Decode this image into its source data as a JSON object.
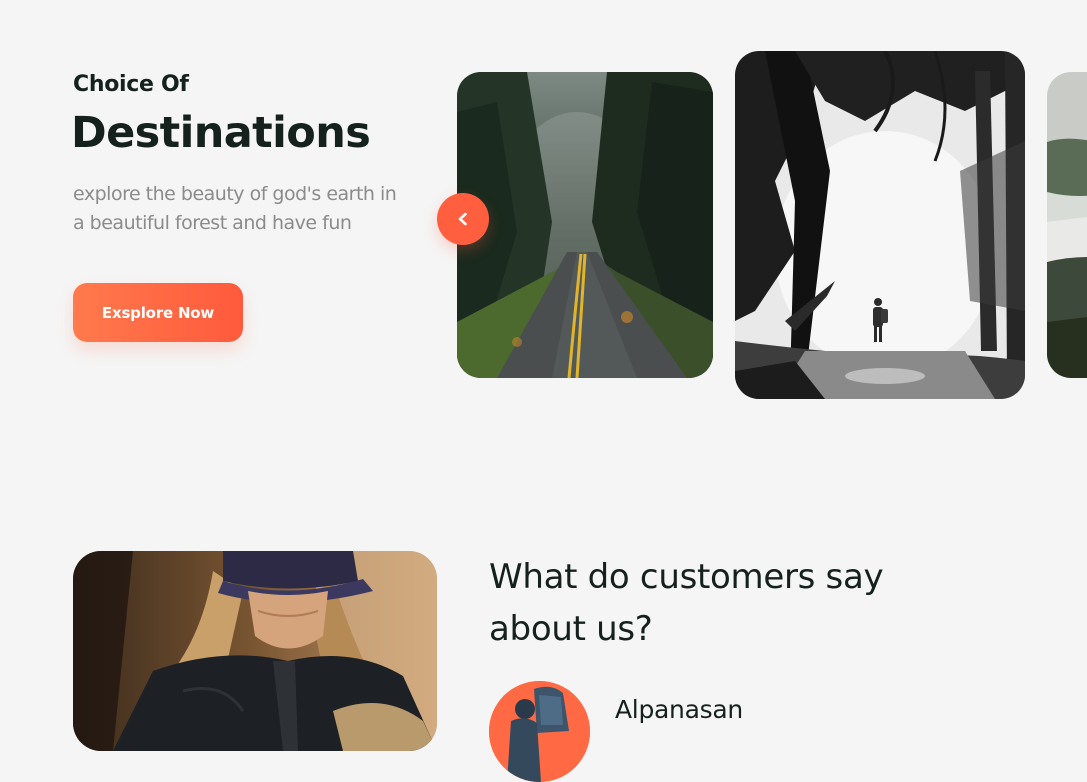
{
  "hero": {
    "eyebrow": "Choice Of",
    "title": "Destinations",
    "description_lines": [
      "explore the beauty of god's earth in",
      "a beautiful forest and have fun"
    ],
    "cta_label": "Exsplore Now",
    "accent_color": "#ff5f3f"
  },
  "carousel": {
    "prev_icon": "chevron-left-icon",
    "images": [
      "forest-road-photo",
      "misty-forest-hiker-photo",
      "foggy-hills-photo"
    ]
  },
  "testimonials": {
    "title_lines": [
      "What do customers say",
      "about us?"
    ],
    "photo": "camper-in-tent-photo",
    "reviewer": {
      "name": "Alpanasan",
      "avatar": "backpacker-avatar"
    }
  }
}
